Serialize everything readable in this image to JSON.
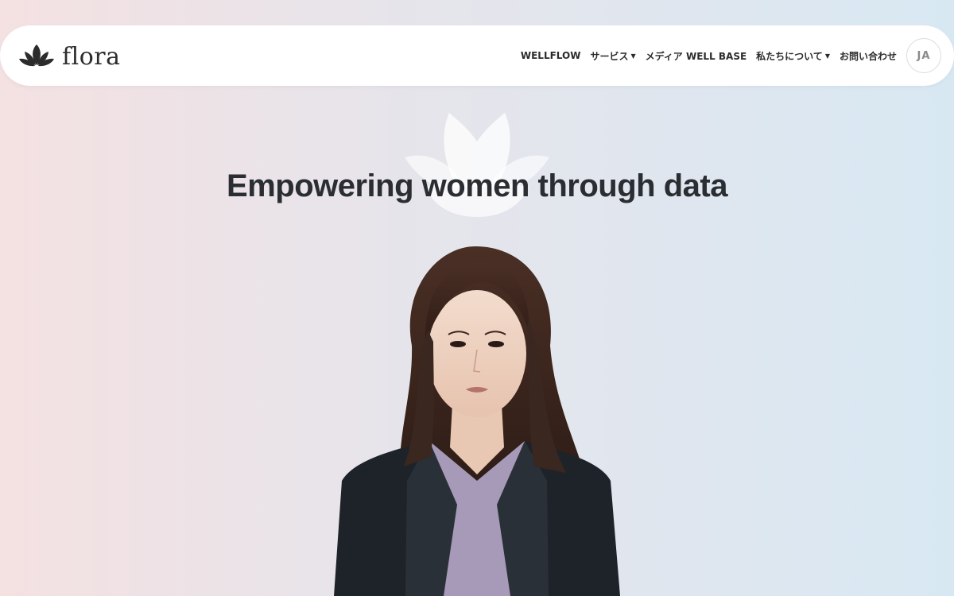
{
  "brand": {
    "name": "flora",
    "logo_icon": "lotus-icon"
  },
  "nav": {
    "items": [
      {
        "label": "WELLFLOW",
        "has_dropdown": false
      },
      {
        "label": "サービス",
        "has_dropdown": true
      },
      {
        "label": "メディア WELL BASE",
        "has_dropdown": false
      },
      {
        "label": "私たちについて",
        "has_dropdown": true
      },
      {
        "label": "お問い合わせ",
        "has_dropdown": false
      }
    ],
    "dropdown_icon": "caret-down-icon",
    "language": "JA"
  },
  "hero": {
    "title": "Empowering women through data",
    "watermark_icon": "lotus-icon",
    "image": "portrait-photo"
  },
  "colors": {
    "text_dark": "#2a2d31",
    "nav_bg": "#ffffff",
    "gradient_left": "#f4e1e2",
    "gradient_right": "#d8e8f3"
  }
}
